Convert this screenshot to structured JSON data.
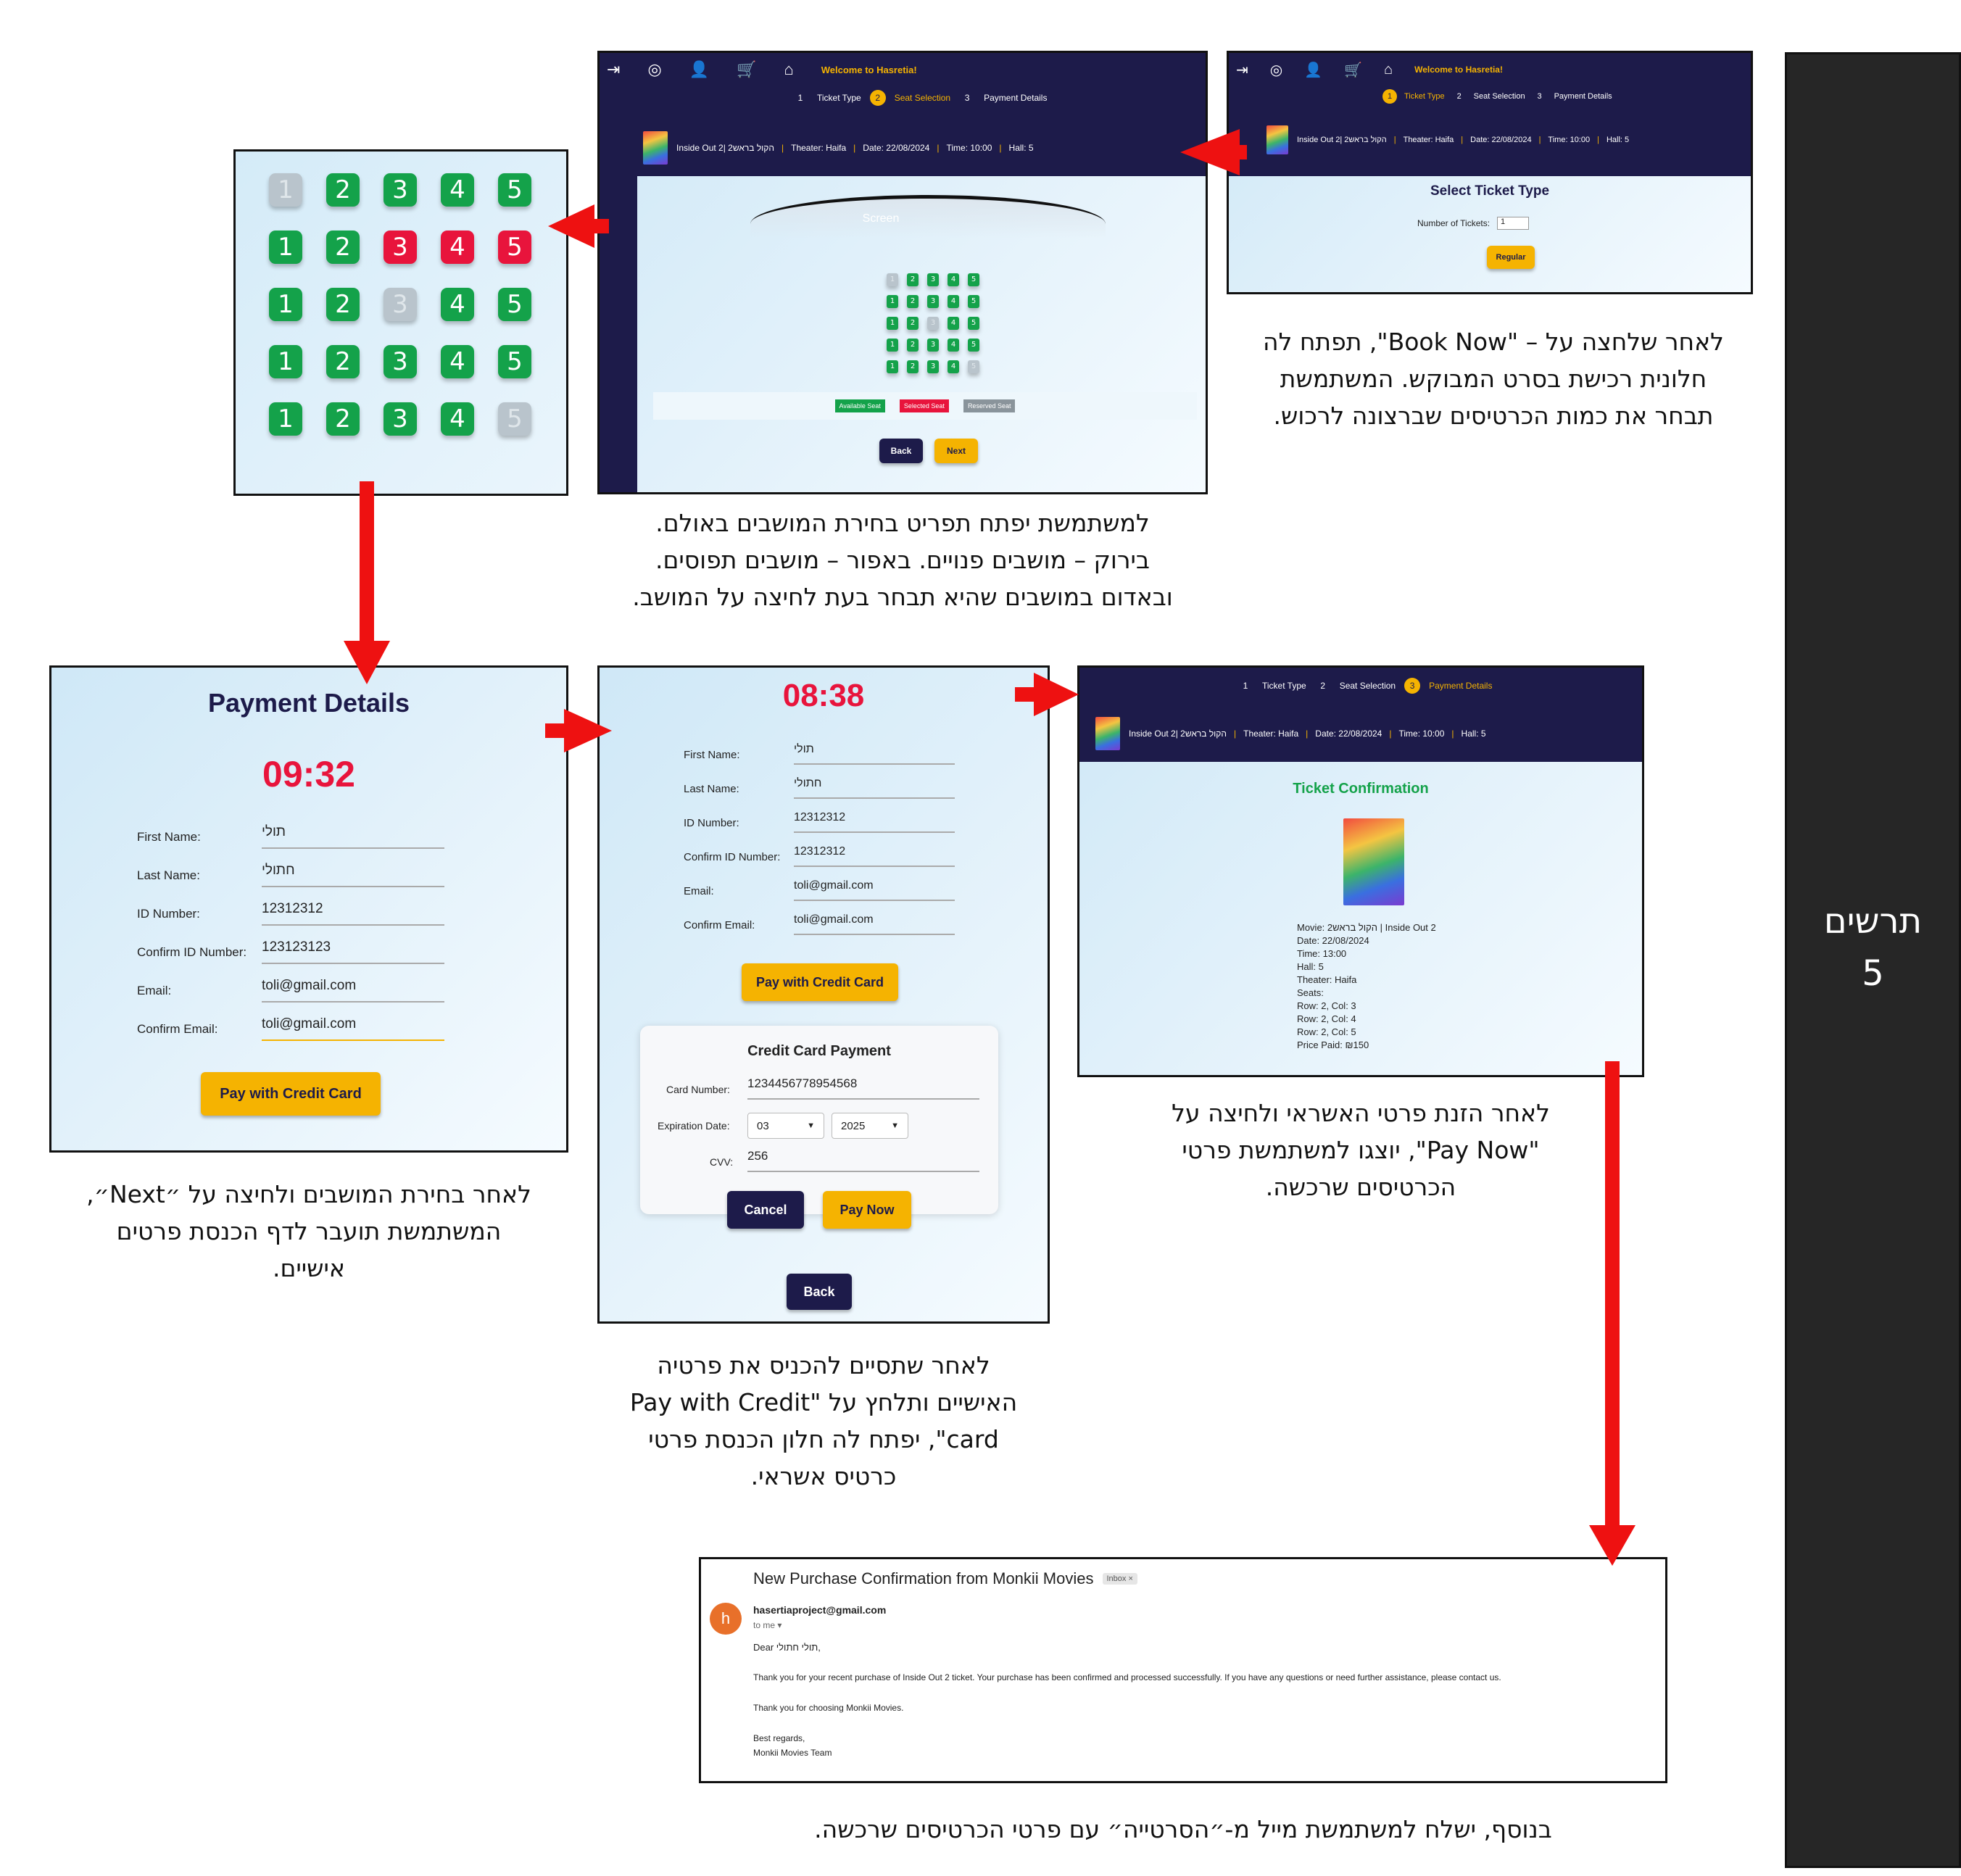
{
  "side_label": {
    "line1": "תרשים",
    "line2": "5"
  },
  "nav": {
    "welcome": "Welcome to Hasretia!"
  },
  "steps": {
    "s1": "1",
    "ticket_type": "Ticket Type",
    "s2": "2",
    "seat_selection": "Seat Selection",
    "s3": "3",
    "payment_details": "Payment Details"
  },
  "movie_info": {
    "title": "Inside Out 2| הקול בראש2",
    "theater": "Theater: Haifa",
    "date": "Date: 22/08/2024",
    "time": "Time: 10:00",
    "hall": "Hall: 5"
  },
  "ticket_screen": {
    "heading": "Select Ticket Type",
    "num_label": "Number of Tickets:",
    "num_value": "1",
    "regular_button": "Regular"
  },
  "seat_screen": {
    "screen_label": "Screen",
    "legend_available": "Available Seat",
    "legend_selected": "Selected Seat",
    "legend_reserved": "Reserved Seat",
    "back_button": "Back",
    "next_button": "Next"
  },
  "seat_grid": {
    "rows": [
      [
        {
          "n": "1",
          "s": "reserved"
        },
        {
          "n": "2",
          "s": "available"
        },
        {
          "n": "3",
          "s": "available"
        },
        {
          "n": "4",
          "s": "available"
        },
        {
          "n": "5",
          "s": "available"
        }
      ],
      [
        {
          "n": "1",
          "s": "available"
        },
        {
          "n": "2",
          "s": "available"
        },
        {
          "n": "3",
          "s": "selected"
        },
        {
          "n": "4",
          "s": "selected"
        },
        {
          "n": "5",
          "s": "selected"
        }
      ],
      [
        {
          "n": "1",
          "s": "available"
        },
        {
          "n": "2",
          "s": "available"
        },
        {
          "n": "3",
          "s": "reserved"
        },
        {
          "n": "4",
          "s": "available"
        },
        {
          "n": "5",
          "s": "available"
        }
      ],
      [
        {
          "n": "1",
          "s": "available"
        },
        {
          "n": "2",
          "s": "available"
        },
        {
          "n": "3",
          "s": "available"
        },
        {
          "n": "4",
          "s": "available"
        },
        {
          "n": "5",
          "s": "available"
        }
      ],
      [
        {
          "n": "1",
          "s": "available"
        },
        {
          "n": "2",
          "s": "available"
        },
        {
          "n": "3",
          "s": "available"
        },
        {
          "n": "4",
          "s": "available"
        },
        {
          "n": "5",
          "s": "reserved"
        }
      ]
    ]
  },
  "payment_screen": {
    "heading": "Payment Details",
    "timer": "09:32",
    "first_name_label": "First Name:",
    "first_name": "תולי",
    "last_name_label": "Last Name:",
    "last_name": "חתולי",
    "id_label": "ID Number:",
    "id": "12312312",
    "confirm_id_label": "Confirm ID Number:",
    "confirm_id": "123123123",
    "email_label": "Email:",
    "email": "toli@gmail.com",
    "confirm_email_label": "Confirm Email:",
    "confirm_email": "toli@gmail.com",
    "pay_button": "Pay with Credit Card"
  },
  "credit_screen": {
    "timer": "08:38",
    "first_name": "תולי",
    "last_name": "חתולי",
    "id": "12312312",
    "confirm_id": "12312312",
    "email": "toli@gmail.com",
    "confirm_email": "toli@gmail.com",
    "pay_button": "Pay with Credit Card",
    "card_heading": "Credit Card Payment",
    "card_number_label": "Card Number:",
    "card_number": "1234456778954568",
    "exp_label": "Expiration Date:",
    "exp_month": "03",
    "exp_year": "2025",
    "cvv_label": "CVV:",
    "cvv": "256",
    "cancel_button": "Cancel",
    "paynow_button": "Pay Now",
    "back_button": "Back"
  },
  "confirmation_screen": {
    "heading": "Ticket Confirmation",
    "lines": [
      "Movie: הקול בראש2 | Inside Out 2",
      "Date: 22/08/2024",
      "Time: 13:00",
      "Hall: 5",
      "Theater: Haifa",
      "Seats:",
      "Row: 2, Col: 3",
      "Row: 2, Col: 4",
      "Row: 2, Col: 5",
      "Price Paid: ₪150"
    ]
  },
  "email": {
    "subject": "New Purchase Confirmation from Monkii Movies",
    "inbox_tag": "Inbox ×",
    "avatar": "h",
    "sender": "hasertiaproject@gmail.com",
    "to": "to me ▾",
    "greeting": "Dear תולי חתולי,",
    "body1": "Thank you for your recent purchase of Inside Out 2 ticket. Your purchase has been confirmed and processed successfully. If you have any questions or need further assistance, please contact us.",
    "body2": "Thank you for choosing Monkii Movies.",
    "regards": "Best regards,",
    "team": "Monkii Movies Team"
  },
  "captions": {
    "c1": [
      "לאחר שלחצה על – \"Book Now\", תפתח לה",
      "חלונית רכישת בסרט המבוקש. המשתמשת",
      "תבחר את כמות הכרטיסים שברצונה לרכוש."
    ],
    "c2": [
      "למשתמשת יפתח תפריט בחירת המושבים באולם.",
      "בירוק – מושבים פנויים. באפור – מושבים תפוסים.",
      "ובאדום במושבים שהיא תבחר בעת לחיצה על המושב."
    ],
    "c3": [
      "לאחר בחירת המושבים ולחיצה על ״Next״,",
      "המשתמשת תועבר לדף הכנסת פרטים",
      "אישיים."
    ],
    "c4": [
      "לאחר שתסיים להכניס את פרטיה",
      "האישיים ותלחץ על \"Pay with Credit",
      "card\", יפתח לה חלון הכנסת פרטי",
      "כרטיס אשראי."
    ],
    "c5": [
      "לאחר הזנת פרטי האשראי ולחיצה על",
      "\"Pay Now\", יוצגו למשתמשת פרטי",
      "הכרטיסים שרכשה."
    ],
    "c6": [
      "בנוסף, ישלח למשתמשת מייל מ-״הסרטייה״ עם פרטי הכרטיסים שרכשה."
    ]
  }
}
